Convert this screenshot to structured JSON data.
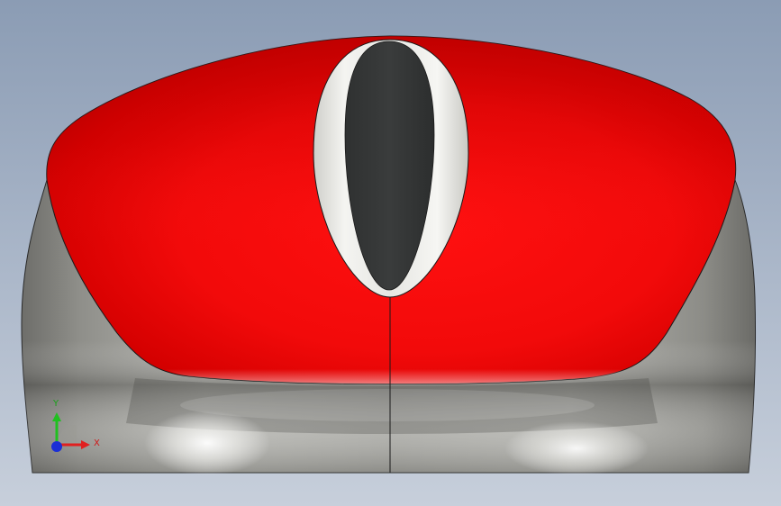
{
  "viewport": {
    "background_top": "#8b9cb4",
    "background_bottom": "#c7cfdb"
  },
  "model": {
    "shell_color": "#e8000a",
    "body_color": "#9c9c97",
    "scroll_wheel_color": "#333535",
    "scroll_wheel_rim_color": "#e6e6e2",
    "edge_color": "#1a1a1a"
  },
  "triad": {
    "x_label": "X",
    "y_label": "Y",
    "x_color": "#e02020",
    "y_color": "#20c020",
    "z_color": "#1a2fd6"
  }
}
